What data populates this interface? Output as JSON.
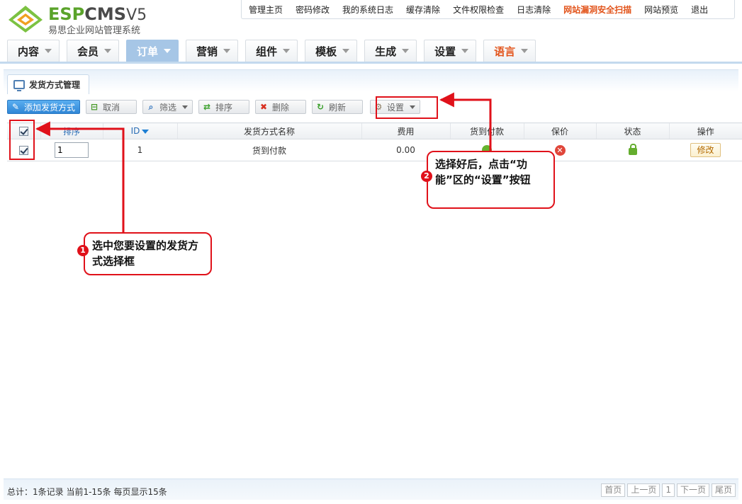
{
  "logo": {
    "brand_e": "ESP",
    "brand_c": "CMS",
    "brand_v": "V5",
    "subtitle": "易思企业网站管理系统"
  },
  "topnav": [
    "管理主页",
    "密码修改",
    "我的系统日志",
    "缓存清除",
    "文件权限检查",
    "日志清除",
    "网站漏洞安全扫描",
    "网站预览",
    "退出"
  ],
  "mainnav": [
    "内容",
    "会员",
    "订单",
    "营销",
    "组件",
    "模板",
    "生成",
    "设置",
    "语言"
  ],
  "panel_tab": "发货方式管理",
  "toolbar": {
    "add": "添加发货方式",
    "cancel": "取消",
    "filter": "筛选",
    "sort": "排序",
    "delete": "删除",
    "refresh": "刷新",
    "settings": "设置"
  },
  "table": {
    "headers": {
      "sort": "排序",
      "id": "ID",
      "name": "发货方式名称",
      "fee": "费用",
      "cod": "货到付款",
      "insured": "保价",
      "status": "状态",
      "action": "操作"
    },
    "rows": [
      {
        "sort": "1",
        "id": "1",
        "name": "货到付款",
        "fee": "0.00",
        "action": "修改"
      }
    ]
  },
  "footer": {
    "info": "总计：1条记录 当前1-15条 每页显示15条",
    "pager": [
      "首页",
      "上一页",
      "1",
      "下一页",
      "尾页"
    ]
  },
  "annotations": {
    "step1_num": "1",
    "step1_text": "选中您要设置的发货方式选择框",
    "step2_num": "2",
    "step2_text": "选择好后，点击“功能”区的“设置”按钮"
  },
  "colors": {
    "accent_red": "#e0111a",
    "nav_active": "#a6c6e6",
    "hot_link": "#e2541b"
  }
}
